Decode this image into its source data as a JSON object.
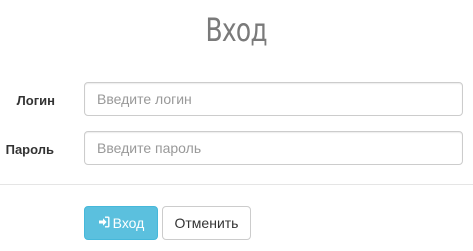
{
  "form": {
    "title": "Вход",
    "login": {
      "label": "Логин",
      "value": "",
      "placeholder": "Введите логин"
    },
    "password": {
      "label": "Пароль",
      "value": "",
      "placeholder": "Введите пароль"
    },
    "buttons": {
      "login_label": "Вход",
      "login_icon": "sign-in-icon",
      "cancel_label": "Отменить"
    }
  },
  "colors": {
    "primary_button": "#5bc0de",
    "primary_button_border": "#46b8da",
    "title_text": "#7a7a7a",
    "input_border": "#cccccc"
  }
}
